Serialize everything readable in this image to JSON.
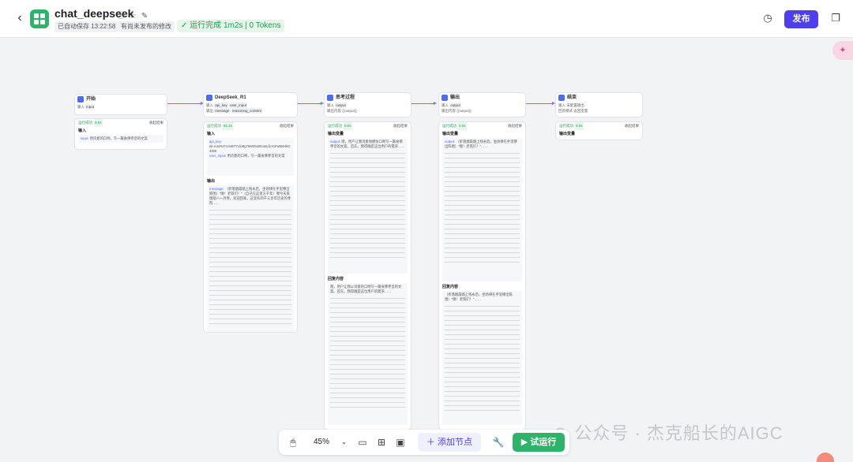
{
  "header": {
    "title": "chat_deepseek",
    "autosave": "已自动保存 13:22:58",
    "unpublished": "有尚未发布的修改",
    "status": "运行完成 1m2s | 0 Tokens",
    "publish": "发布"
  },
  "nodes": {
    "start": {
      "title": "开始",
      "row1_key": "输入",
      "row1_val": "input"
    },
    "deepseek": {
      "title": "DeepSeek_R1",
      "in_key": "输入",
      "in_tags": [
        "api_key",
        "user_input"
      ],
      "out_key": "输出",
      "out_tags": [
        "message",
        "reasoning_content"
      ]
    },
    "think": {
      "title": "思考过程",
      "in_key": "输入",
      "in_tag": "output",
      "out_key": "输出内容",
      "out_val": "{{output}}"
    },
    "output": {
      "title": "输出",
      "in_key": "输入",
      "in_tag": "output",
      "out_key": "输出内容",
      "out_val": "{{output}}"
    },
    "end": {
      "title": "结束",
      "in_key": "输入",
      "in_val": "未配置输出",
      "out_key": "回答模式",
      "out_val": "返回变量"
    }
  },
  "panels": {
    "start": {
      "status": "运行成功",
      "time": "0.0s",
      "right": "收起结果",
      "section": "输入",
      "key": "input",
      "text": "用诗意的口吻，写一篇食佛寺音的文案"
    },
    "deepseek": {
      "status": "运行成功",
      "time": "61.2s",
      "right": "收起结果",
      "section_in": "输入",
      "api_key_label": "api_key:",
      "api_key_val": "sk-A4cRcF13xBTYxlo9g75M35oBCwtLfyYoPuBKHkG4ID8",
      "user_input_label": "user_input:",
      "user_input_val": "用诗意的口吻，写一篇食佛寺音的文案",
      "section_out": "输出",
      "message_label": "message:",
      "message_text": "（折落烟霞踏上残永后，坐场律在手里撑出陈围）\"嗅！老铁们！\"（自己在这里方千年）我今天来围观八一月寺，欢迎回家，这里有四千三百年历史的寺院……"
    },
    "think": {
      "status": "运行成功",
      "time": "0.0s",
      "right": "收起结果",
      "section_out": "输出变量",
      "output_label": "output:",
      "output_text": "嗯，用户让我诗意地模仿口吻写一篇食佛寺音的文案。首先，我得确定这位用户的需求……",
      "section_reply": "回复内容",
      "reply_text": "嗯，用户让我以诗意的口吻写一篇食佛寺音的文案。首先，我得确定这位用户的需求……"
    },
    "output": {
      "status": "运行成功",
      "time": "0.0s",
      "right": "收起结果",
      "section_out": "输出变量",
      "output_label": "output:",
      "output_text": "（折落烟霞踏上残永后，坐场律在手里撑出陈围）\"嗅！老铁们！\"……",
      "section_reply": "回复内容",
      "reply_text": "（折落烟霞踏上残永后，坐场律在手里撑出陈围）\"嗅！老铁们！\"……"
    },
    "end": {
      "status": "运行成功",
      "time": "0.0s",
      "right": "收起结果",
      "section_out": "输出变量"
    }
  },
  "toolbar": {
    "zoom": "45%",
    "add_node": "添加节点",
    "run": "试运行"
  },
  "watermark": "公众号 · 杰克船长的AIGC",
  "colors": {
    "accent": "#4d3ff0",
    "success": "#2fb36a",
    "edge": "#6c7cf0"
  }
}
